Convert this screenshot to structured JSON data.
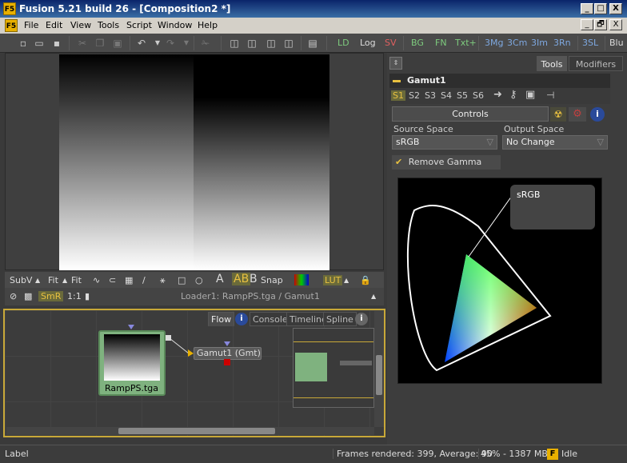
{
  "window": {
    "title": "Fusion 5.21 build 26 - [Composition2 *]",
    "app_icon": "F5",
    "min": "_",
    "max": "□",
    "close": "X",
    "restore": "🗗"
  },
  "menu": [
    "File",
    "Edit",
    "View",
    "Tools",
    "Script",
    "Window",
    "Help"
  ],
  "toolbar": {
    "buttons": [
      "LD",
      "Log",
      "SV",
      "BG",
      "FN",
      "Txt+",
      "3Mg",
      "3Cm",
      "3Im",
      "3Rn",
      "3SL",
      "Blu"
    ],
    "colors": {
      "LD": "#7ecb7e",
      "Log": "#dddddd",
      "SV": "#e06060",
      "BG": "#7ecb7e",
      "FN": "#7ecb7e",
      "Txt+": "#7ecb7e",
      "3Mg": "#7ea8e0",
      "3Cm": "#7ea8e0",
      "3Im": "#7ea8e0",
      "3Rn": "#7ea8e0",
      "3SL": "#7ea8e0",
      "Blu": "#dddddd"
    }
  },
  "viewer": {
    "subv": "SubV",
    "fit1": "Fit",
    "fit2": "Fit",
    "snap": "Snap",
    "lut": "LUT",
    "smr": "SmR",
    "ratio": "1:1",
    "path": "Loader1: RampPS.tga / Gamut1",
    "letters": [
      "A",
      "AB",
      "B"
    ]
  },
  "flow": {
    "tabs": [
      "Flow",
      "Console",
      "Timeline",
      "Spline"
    ],
    "node1": "RampPS.tga",
    "node2": "Gamut1 (Gmt)"
  },
  "rightpanel": {
    "tabs": [
      "Tools",
      "Modifiers"
    ],
    "tool_name": "Gamut1",
    "slots": [
      "S1",
      "S2",
      "S3",
      "S4",
      "S5",
      "S6"
    ],
    "controls_tab": "Controls",
    "source_space_label": "Source Space",
    "source_space_value": "sRGB",
    "output_space_label": "Output Space",
    "output_space_value": "No Change",
    "remove_gamma": "Remove Gamma",
    "cie_label": "sRGB"
  },
  "status": {
    "label": "Label",
    "frames": "Frames rendered: 399,  Average: 90",
    "memory": "45% - 1387 MB",
    "state": "Idle",
    "state_icon": "F"
  }
}
